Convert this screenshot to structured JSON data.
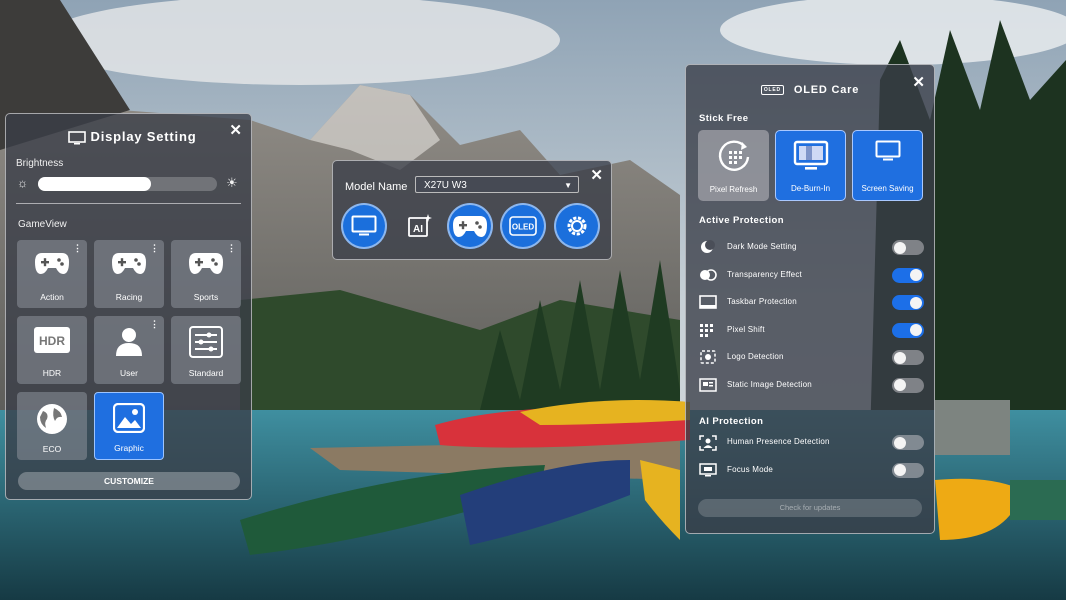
{
  "display_setting": {
    "title": "Display Setting",
    "brightness_label": "Brightness",
    "brightness_level_percent": 63,
    "gameview_label": "GameView",
    "tiles": [
      {
        "label": "Action",
        "icon": "gamepad-icon",
        "menu": true,
        "active": false
      },
      {
        "label": "Racing",
        "icon": "gamepad-icon",
        "menu": true,
        "active": false
      },
      {
        "label": "Sports",
        "icon": "gamepad-icon",
        "menu": true,
        "active": false
      },
      {
        "label": "HDR",
        "icon": "hdr-icon",
        "icon_text": "HDR",
        "menu": false,
        "active": false
      },
      {
        "label": "User",
        "icon": "user-icon",
        "menu": true,
        "active": false
      },
      {
        "label": "Standard",
        "icon": "sliders-icon",
        "menu": false,
        "active": false
      },
      {
        "label": "ECO",
        "icon": "globe-icon",
        "menu": false,
        "active": false
      },
      {
        "label": "Graphic",
        "icon": "image-icon",
        "menu": false,
        "active": true
      }
    ],
    "customize_label": "CUSTOMIZE"
  },
  "model_panel": {
    "label": "Model Name",
    "selected": "X27U W3",
    "buttons": [
      {
        "name": "display-button",
        "icon": "monitor-icon"
      },
      {
        "name": "ai-button",
        "icon": "ai-icon"
      },
      {
        "name": "game-button",
        "icon": "gamepad-icon"
      },
      {
        "name": "oled-button",
        "icon": "oled-icon",
        "icon_text": "OLED"
      },
      {
        "name": "settings-button",
        "icon": "gear-icon"
      }
    ]
  },
  "oled_care": {
    "badge": "OLED",
    "title": "OLED Care",
    "stick_free_label": "Stick Free",
    "stick_free_buttons": [
      {
        "label": "Pixel Refresh",
        "icon": "refresh-grid-icon",
        "active": false
      },
      {
        "label": "De-Burn-In",
        "icon": "monitor-burn-icon",
        "active": true
      },
      {
        "label": "Screen Saving",
        "icon": "monitor-icon",
        "active": true
      }
    ],
    "active_protection_label": "Active Protection",
    "active_rows": [
      {
        "label": "Dark Mode Setting",
        "icon": "moon-icon",
        "on": false
      },
      {
        "label": "Transparency Effect",
        "icon": "transparency-icon",
        "on": true
      },
      {
        "label": "Taskbar Protection",
        "icon": "taskbar-icon",
        "on": true
      },
      {
        "label": "Pixel Shift",
        "icon": "pixel-grid-icon",
        "on": true
      },
      {
        "label": "Logo Detection",
        "icon": "logo-detect-icon",
        "on": false
      },
      {
        "label": "Static Image Detection",
        "icon": "static-image-icon",
        "on": false
      }
    ],
    "ai_protection_label": "AI Protection",
    "ai_rows": [
      {
        "label": "Human Presence Detection",
        "icon": "human-detect-icon",
        "on": false
      },
      {
        "label": "Focus Mode",
        "icon": "focus-icon",
        "on": false
      }
    ],
    "check_update_label": "Check for updates"
  },
  "colors": {
    "accent": "#1f6fe0",
    "panel": "#3a3e48"
  }
}
